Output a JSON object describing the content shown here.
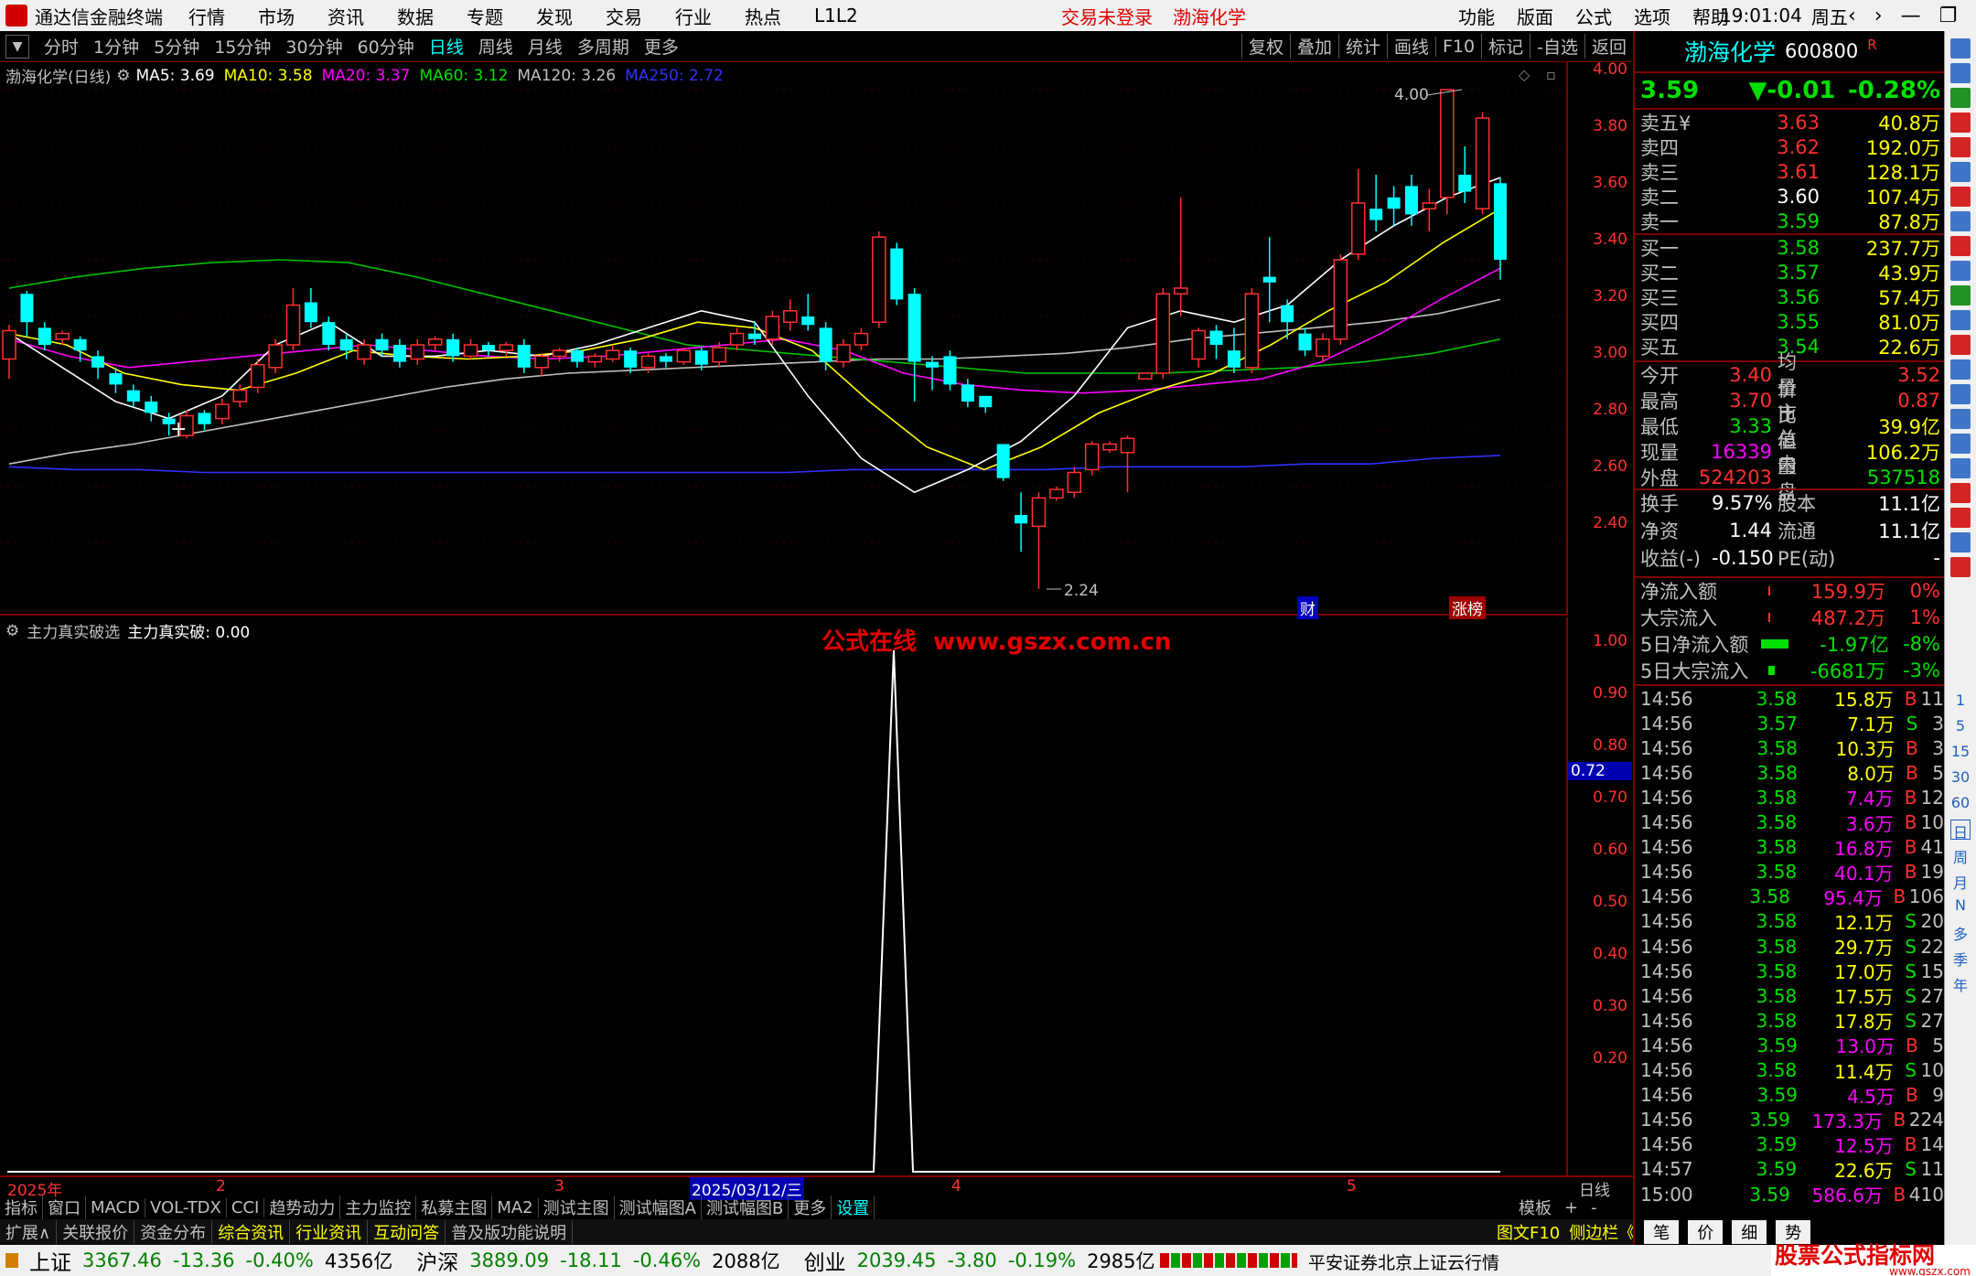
{
  "titlebar": {
    "app_title": "通达信金融终端",
    "menu": [
      "行情",
      "市场",
      "资讯",
      "数据",
      "专题",
      "发现",
      "交易",
      "行业",
      "热点",
      "L1L2"
    ],
    "notice_login": "交易未登录",
    "notice_stock": "渤海化学",
    "right_menu": [
      "功能",
      "版面",
      "公式",
      "选项",
      "帮助"
    ],
    "time": "19:01:04",
    "weekday": "周五"
  },
  "periods": [
    "分时",
    "1分钟",
    "5分钟",
    "15分钟",
    "30分钟",
    "60分钟",
    "日线",
    "周线",
    "月线",
    "多周期",
    "更多"
  ],
  "active_period": "日线",
  "toolbar_right": [
    "复权",
    "叠加",
    "统计",
    "画线",
    "F10",
    "标记",
    "-自选",
    "返回"
  ],
  "main_chart": {
    "header": "渤海化学(日线)",
    "ma": [
      {
        "label": "MA5: 3.69",
        "color": "#ffffff"
      },
      {
        "label": "MA10: 3.58",
        "color": "#ffff00"
      },
      {
        "label": "MA20: 3.37",
        "color": "#ff00ff"
      },
      {
        "label": "MA60: 3.12",
        "color": "#00e000"
      },
      {
        "label": "MA120: 3.26",
        "color": "#c0c0c0"
      },
      {
        "label": "MA250: 2.72",
        "color": "#3030ff"
      }
    ],
    "yticks": [
      "4.00",
      "3.80",
      "3.60",
      "3.40",
      "3.20",
      "3.00",
      "2.80",
      "2.60",
      "2.40"
    ],
    "high_label": "4.00",
    "low_label": "2.24",
    "badge_cai": "财",
    "badge_zhang": "涨榜"
  },
  "sub_chart": {
    "header_name": "主力真实破选",
    "header_value": "主力真实破: 0.00",
    "watermark": "公式在线  www.gszx.com.cn",
    "yticks": [
      "1.00",
      "0.90",
      "0.80",
      "0.70",
      "0.60",
      "0.50",
      "0.40",
      "0.30",
      "0.20"
    ],
    "marker": "0.72"
  },
  "xaxis": {
    "labels": [
      "2025年",
      "2",
      "3",
      "2025/03/12/三",
      "4",
      "5"
    ],
    "right": "日线"
  },
  "bottom_tabs": [
    "指标",
    "窗口",
    "MACD",
    "VOL-TDX",
    "CCI",
    "趋势动力",
    "主力监控",
    "私募主图",
    "MA2",
    "测试主图",
    "测试幅图A",
    "测试幅图B",
    "更多",
    "设置"
  ],
  "bottom_tabs_right": [
    "模板",
    "+",
    "-"
  ],
  "bottom_tabs2": [
    "扩展∧",
    "关联报价",
    "资金分布",
    "综合资讯",
    "行业资讯",
    "互动问答",
    "普及版功能说明"
  ],
  "bottom_tabs2_right": [
    "图文F10",
    "侧边栏《",
    "笔",
    "价",
    "细",
    "势"
  ],
  "statusbar": {
    "items": [
      {
        "name": "上证",
        "price": "3367.46",
        "chg": "-13.36",
        "pct": "-0.40%",
        "amt": "4356亿"
      },
      {
        "name": "沪深",
        "price": "3889.09",
        "chg": "-18.11",
        "pct": "-0.46%",
        "amt": "2088亿"
      },
      {
        "name": "创业",
        "price": "2039.45",
        "chg": "-3.80",
        "pct": "-0.19%",
        "amt": "2985亿"
      }
    ],
    "broker": "平安证券北京上证云行情",
    "brand": "股票公式指标网",
    "brand_url": "www.gszx.com"
  },
  "quote": {
    "name": "渤海化学",
    "code": "600800",
    "flag": "R",
    "price": "3.59",
    "change": "▼-0.01",
    "pct": "-0.28%",
    "sell": [
      {
        "label": "卖五¥",
        "price": "3.63",
        "vol": "40.8万"
      },
      {
        "label": "卖四",
        "price": "3.62",
        "vol": "192.0万"
      },
      {
        "label": "卖三",
        "price": "3.61",
        "vol": "128.1万"
      },
      {
        "label": "卖二",
        "price": "3.60",
        "vol": "107.4万"
      },
      {
        "label": "卖一",
        "price": "3.59",
        "vol": "87.8万"
      }
    ],
    "buy": [
      {
        "label": "买一",
        "price": "3.58",
        "vol": "237.7万"
      },
      {
        "label": "买二",
        "price": "3.57",
        "vol": "43.9万"
      },
      {
        "label": "买三",
        "price": "3.56",
        "vol": "57.4万"
      },
      {
        "label": "买四",
        "price": "3.55",
        "vol": "81.0万"
      },
      {
        "label": "买五",
        "price": "3.54",
        "vol": "22.6万"
      }
    ],
    "stats": [
      {
        "a": "今开",
        "b": "3.40",
        "c": "均价",
        "d": "3.52"
      },
      {
        "a": "最高",
        "b": "3.70",
        "c": "量比",
        "d": "0.87"
      },
      {
        "a": "最低",
        "b": "3.33",
        "c": "市值",
        "d": "39.9亿"
      },
      {
        "a": "现量",
        "b": "16339",
        "c": "总量",
        "d": "106.2万"
      },
      {
        "a": "外盘",
        "b": "524203",
        "c": "内盘",
        "d": "537518"
      }
    ],
    "stats2": [
      {
        "a": "换手",
        "b": "9.57%",
        "c": "股本",
        "d": "11.1亿"
      },
      {
        "a": "净资",
        "b": "1.44",
        "c": "流通",
        "d": "11.1亿"
      },
      {
        "a": "收益(-)",
        "b": "-0.150",
        "c": "PE(动)",
        "d": "-"
      }
    ],
    "flows": [
      {
        "label": "净流入额",
        "val": "159.9万",
        "pct": "0%"
      },
      {
        "label": "大宗流入",
        "val": "487.2万",
        "pct": "1%"
      },
      {
        "label": "5日净流入额",
        "val": "-1.97亿",
        "pct": "-8%"
      },
      {
        "label": "5日大宗流入",
        "val": "-6681万",
        "pct": "-3%"
      }
    ],
    "ticks": [
      {
        "t": "14:56",
        "p": "3.58",
        "v": "15.8万",
        "d": "B",
        "n": "11"
      },
      {
        "t": "14:56",
        "p": "3.57",
        "v": "7.1万",
        "d": "S",
        "n": "3"
      },
      {
        "t": "14:56",
        "p": "3.58",
        "v": "10.3万",
        "d": "B",
        "n": "3"
      },
      {
        "t": "14:56",
        "p": "3.58",
        "v": "8.0万",
        "d": "B",
        "n": "5"
      },
      {
        "t": "14:56",
        "p": "3.58",
        "v": "7.4万",
        "d": "B",
        "n": "12"
      },
      {
        "t": "14:56",
        "p": "3.58",
        "v": "3.6万",
        "d": "B",
        "n": "10"
      },
      {
        "t": "14:56",
        "p": "3.58",
        "v": "16.8万",
        "d": "B",
        "n": "41"
      },
      {
        "t": "14:56",
        "p": "3.58",
        "v": "40.1万",
        "d": "B",
        "n": "19"
      },
      {
        "t": "14:56",
        "p": "3.58",
        "v": "95.4万",
        "d": "B",
        "n": "106"
      },
      {
        "t": "14:56",
        "p": "3.58",
        "v": "12.1万",
        "d": "S",
        "n": "20"
      },
      {
        "t": "14:56",
        "p": "3.58",
        "v": "29.7万",
        "d": "S",
        "n": "22"
      },
      {
        "t": "14:56",
        "p": "3.58",
        "v": "17.0万",
        "d": "S",
        "n": "15"
      },
      {
        "t": "14:56",
        "p": "3.58",
        "v": "17.5万",
        "d": "S",
        "n": "27"
      },
      {
        "t": "14:56",
        "p": "3.58",
        "v": "17.8万",
        "d": "S",
        "n": "27"
      },
      {
        "t": "14:56",
        "p": "3.59",
        "v": "13.0万",
        "d": "B",
        "n": "5"
      },
      {
        "t": "14:56",
        "p": "3.58",
        "v": "11.4万",
        "d": "S",
        "n": "10"
      },
      {
        "t": "14:56",
        "p": "3.59",
        "v": "4.5万",
        "d": "B",
        "n": "9"
      },
      {
        "t": "14:56",
        "p": "3.59",
        "v": "173.3万",
        "d": "B",
        "n": "224"
      },
      {
        "t": "14:56",
        "p": "3.59",
        "v": "12.5万",
        "d": "B",
        "n": "14"
      },
      {
        "t": "14:57",
        "p": "3.59",
        "v": "22.6万",
        "d": "S",
        "n": "11"
      },
      {
        "t": "15:00",
        "p": "3.59",
        "v": "586.6万",
        "d": "B",
        "n": "410"
      }
    ]
  },
  "sidebar_labels": [
    "1",
    "5",
    "15",
    "30",
    "60",
    "日",
    "周",
    "月",
    "N",
    "多",
    "季",
    "年"
  ]
}
